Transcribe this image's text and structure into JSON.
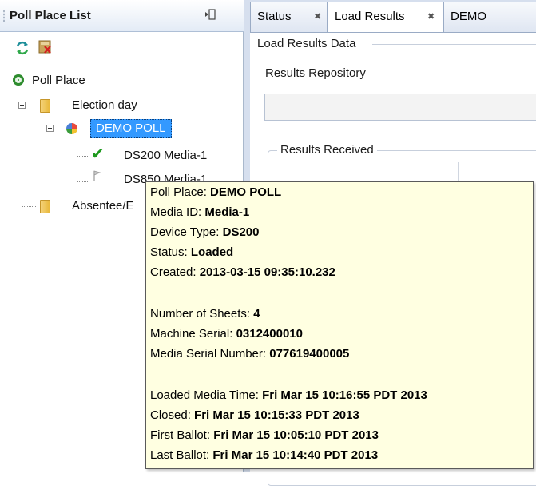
{
  "left_panel": {
    "title": "Poll Place List",
    "tree": {
      "root": "Poll Place",
      "election_day": "Election day",
      "demo_poll": "DEMO POLL",
      "media1": "DS200 Media-1",
      "media2": "DS850 Media-1",
      "absentee": "Absentee/E"
    }
  },
  "tabs": [
    {
      "label": "Status"
    },
    {
      "label": "Load Results"
    },
    {
      "label": "DEMO"
    }
  ],
  "content": {
    "section_title": "Load Results Data",
    "repository_label": "Results Repository",
    "repository_value": "",
    "received_label": "Results Received"
  },
  "tooltip": {
    "poll_place_key": "Poll Place:",
    "poll_place_val": "DEMO POLL",
    "media_id_key": "Media ID:",
    "media_id_val": "Media-1",
    "device_type_key": "Device Type:",
    "device_type_val": "DS200",
    "status_key": "Status:",
    "status_val": "Loaded",
    "created_key": "Created:",
    "created_val": "2013-03-15 09:35:10.232",
    "sheets_key": "Number of Sheets:",
    "sheets_val": "4",
    "machine_serial_key": "Machine Serial:",
    "machine_serial_val": "0312400010",
    "media_serial_key": "Media Serial Number:",
    "media_serial_val": "077619400005",
    "loaded_time_key": "Loaded Media Time:",
    "loaded_time_val": "Fri Mar 15 10:16:55 PDT 2013",
    "closed_key": "Closed:",
    "closed_val": "Fri Mar 15 10:15:33 PDT 2013",
    "first_ballot_key": "First Ballot:",
    "first_ballot_val": "Fri Mar 15 10:05:10 PDT 2013",
    "last_ballot_key": "Last Ballot:",
    "last_ballot_val": "Fri Mar 15 10:14:40 PDT 2013"
  },
  "icons": {
    "refresh": "refresh-icon",
    "delete": "delete-icon",
    "minimize": "minimize-panel-icon",
    "check": "check-icon",
    "flag": "flag-icon"
  },
  "colors": {
    "selection": "#3399ff",
    "tooltip_bg": "#ffffe1",
    "panel_bg": "#d6dfee"
  }
}
